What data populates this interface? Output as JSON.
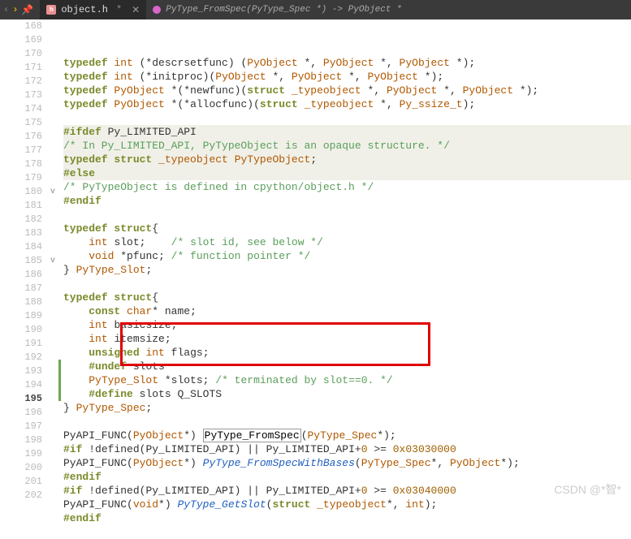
{
  "tabbar": {
    "back": "‹",
    "fwd": "›",
    "pin": "📌",
    "tab": {
      "icon": "h",
      "name": "object.h",
      "modified": "*",
      "close": "✕"
    },
    "breadcrumb": "PyType_FromSpec(PyType_Spec *) -> PyObject *"
  },
  "lines": [
    {
      "n": 168,
      "tokens": [
        [
          "kw",
          "typedef"
        ],
        [
          "op",
          " "
        ],
        [
          "ty",
          "int"
        ],
        [
          "op",
          " (*"
        ],
        [
          "id",
          "descrsetfunc"
        ],
        [
          "op",
          ") ("
        ],
        [
          "ty",
          "PyObject"
        ],
        [
          "op",
          " *, "
        ],
        [
          "ty",
          "PyObject"
        ],
        [
          "op",
          " *, "
        ],
        [
          "ty",
          "PyObject"
        ],
        [
          "op",
          " *);"
        ]
      ]
    },
    {
      "n": 169,
      "tokens": [
        [
          "kw",
          "typedef"
        ],
        [
          "op",
          " "
        ],
        [
          "ty",
          "int"
        ],
        [
          "op",
          " (*"
        ],
        [
          "id",
          "initproc"
        ],
        [
          "op",
          ")("
        ],
        [
          "ty",
          "PyObject"
        ],
        [
          "op",
          " *, "
        ],
        [
          "ty",
          "PyObject"
        ],
        [
          "op",
          " *, "
        ],
        [
          "ty",
          "PyObject"
        ],
        [
          "op",
          " *);"
        ]
      ]
    },
    {
      "n": 170,
      "tokens": [
        [
          "kw",
          "typedef"
        ],
        [
          "op",
          " "
        ],
        [
          "ty",
          "PyObject"
        ],
        [
          "op",
          " *(*"
        ],
        [
          "id",
          "newfunc"
        ],
        [
          "op",
          ")("
        ],
        [
          "kw",
          "struct"
        ],
        [
          "op",
          " "
        ],
        [
          "ty",
          "_typeobject"
        ],
        [
          "op",
          " *, "
        ],
        [
          "ty",
          "PyObject"
        ],
        [
          "op",
          " *, "
        ],
        [
          "ty",
          "PyObject"
        ],
        [
          "op",
          " *);"
        ]
      ]
    },
    {
      "n": 171,
      "tokens": [
        [
          "kw",
          "typedef"
        ],
        [
          "op",
          " "
        ],
        [
          "ty",
          "PyObject"
        ],
        [
          "op",
          " *(*"
        ],
        [
          "id",
          "allocfunc"
        ],
        [
          "op",
          ")("
        ],
        [
          "kw",
          "struct"
        ],
        [
          "op",
          " "
        ],
        [
          "ty",
          "_typeobject"
        ],
        [
          "op",
          " *, "
        ],
        [
          "ty",
          "Py_ssize_t"
        ],
        [
          "op",
          ");"
        ]
      ]
    },
    {
      "n": 172,
      "tokens": []
    },
    {
      "n": 173,
      "tokens": [
        [
          "pp",
          "#ifdef"
        ],
        [
          "op",
          " "
        ],
        [
          "id",
          "Py_LIMITED_API"
        ]
      ],
      "hl": true
    },
    {
      "n": 174,
      "tokens": [
        [
          "cm",
          "/* In Py_LIMITED_API, PyTypeObject is an opaque structure. */"
        ]
      ],
      "hl": true
    },
    {
      "n": 175,
      "tokens": [
        [
          "kw",
          "typedef"
        ],
        [
          "op",
          " "
        ],
        [
          "kw",
          "struct"
        ],
        [
          "op",
          " "
        ],
        [
          "ty",
          "_typeobject"
        ],
        [
          "op",
          " "
        ],
        [
          "ty",
          "PyTypeObject"
        ],
        [
          "op",
          ";"
        ]
      ],
      "hl": true
    },
    {
      "n": 176,
      "tokens": [
        [
          "pp",
          "#else"
        ]
      ],
      "hl": true
    },
    {
      "n": 177,
      "tokens": [
        [
          "cm",
          "/* PyTypeObject is defined in cpython/object.h */"
        ]
      ]
    },
    {
      "n": 178,
      "tokens": [
        [
          "pp",
          "#endif"
        ]
      ]
    },
    {
      "n": 179,
      "tokens": []
    },
    {
      "n": 180,
      "tokens": [
        [
          "kw",
          "typedef"
        ],
        [
          "op",
          " "
        ],
        [
          "kw",
          "struct"
        ],
        [
          "op",
          "{"
        ]
      ],
      "fold": "v"
    },
    {
      "n": 181,
      "tokens": [
        [
          "op",
          "    "
        ],
        [
          "ty",
          "int"
        ],
        [
          "op",
          " "
        ],
        [
          "id",
          "slot"
        ],
        [
          "op",
          ";    "
        ],
        [
          "cm",
          "/* slot id, see below */"
        ]
      ]
    },
    {
      "n": 182,
      "tokens": [
        [
          "op",
          "    "
        ],
        [
          "ty",
          "void"
        ],
        [
          "op",
          " *"
        ],
        [
          "id",
          "pfunc"
        ],
        [
          "op",
          "; "
        ],
        [
          "cm",
          "/* function pointer */"
        ]
      ]
    },
    {
      "n": 183,
      "tokens": [
        [
          "op",
          "} "
        ],
        [
          "ty",
          "PyType_Slot"
        ],
        [
          "op",
          ";"
        ]
      ]
    },
    {
      "n": 184,
      "tokens": []
    },
    {
      "n": 185,
      "tokens": [
        [
          "kw",
          "typedef"
        ],
        [
          "op",
          " "
        ],
        [
          "kw",
          "struct"
        ],
        [
          "op",
          "{"
        ]
      ],
      "fold": "v"
    },
    {
      "n": 186,
      "tokens": [
        [
          "op",
          "    "
        ],
        [
          "kw",
          "const"
        ],
        [
          "op",
          " "
        ],
        [
          "ty",
          "char"
        ],
        [
          "op",
          "* "
        ],
        [
          "id",
          "name"
        ],
        [
          "op",
          ";"
        ]
      ]
    },
    {
      "n": 187,
      "tokens": [
        [
          "op",
          "    "
        ],
        [
          "ty",
          "int"
        ],
        [
          "op",
          " "
        ],
        [
          "id",
          "basicsize"
        ],
        [
          "op",
          ";"
        ]
      ]
    },
    {
      "n": 188,
      "tokens": [
        [
          "op",
          "    "
        ],
        [
          "ty",
          "int"
        ],
        [
          "op",
          " "
        ],
        [
          "id",
          "itemsize"
        ],
        [
          "op",
          ";"
        ]
      ]
    },
    {
      "n": 189,
      "tokens": [
        [
          "op",
          "    "
        ],
        [
          "kw",
          "unsigned"
        ],
        [
          "op",
          " "
        ],
        [
          "ty",
          "int"
        ],
        [
          "op",
          " "
        ],
        [
          "id",
          "flags"
        ],
        [
          "op",
          ";"
        ]
      ]
    },
    {
      "n": 190,
      "tokens": [
        [
          "op",
          "    "
        ],
        [
          "pp",
          "#undef"
        ],
        [
          "op",
          " "
        ],
        [
          "id",
          "slots"
        ]
      ],
      "green": true
    },
    {
      "n": 191,
      "tokens": [
        [
          "op",
          "    "
        ],
        [
          "ty",
          "PyType_Slot"
        ],
        [
          "op",
          " *"
        ],
        [
          "id",
          "slots"
        ],
        [
          "op",
          "; "
        ],
        [
          "cm",
          "/* terminated by slot==0. */"
        ]
      ],
      "green": true
    },
    {
      "n": 192,
      "tokens": [
        [
          "op",
          "    "
        ],
        [
          "pp",
          "#define"
        ],
        [
          "op",
          " "
        ],
        [
          "id",
          "slots"
        ],
        [
          "op",
          " "
        ],
        [
          "id",
          "Q_SLOTS"
        ]
      ],
      "green": true
    },
    {
      "n": 193,
      "tokens": [
        [
          "op",
          "} "
        ],
        [
          "ty",
          "PyType_Spec"
        ],
        [
          "op",
          ";"
        ]
      ]
    },
    {
      "n": 194,
      "tokens": []
    },
    {
      "n": 195,
      "tokens": [
        [
          "id",
          "PyAPI_FUNC"
        ],
        [
          "op",
          "("
        ],
        [
          "ty",
          "PyObject"
        ],
        [
          "op",
          "*) "
        ],
        [
          "fnref",
          "PyType_FromSpec"
        ],
        [
          "op",
          "("
        ],
        [
          "ty",
          "PyType_Spec"
        ],
        [
          "op",
          "*);"
        ]
      ],
      "current": true
    },
    {
      "n": 196,
      "tokens": [
        [
          "pp",
          "#if"
        ],
        [
          "op",
          " !"
        ],
        [
          "id",
          "defined"
        ],
        [
          "op",
          "("
        ],
        [
          "id",
          "Py_LIMITED_API"
        ],
        [
          "op",
          ") || "
        ],
        [
          "id",
          "Py_LIMITED_API"
        ],
        [
          "op",
          "+"
        ],
        [
          "num",
          "0"
        ],
        [
          "op",
          " >= "
        ],
        [
          "num",
          "0x03030000"
        ]
      ]
    },
    {
      "n": 197,
      "tokens": [
        [
          "id",
          "PyAPI_FUNC"
        ],
        [
          "op",
          "("
        ],
        [
          "ty",
          "PyObject"
        ],
        [
          "op",
          "*) "
        ],
        [
          "fn",
          "PyType_FromSpecWithBases"
        ],
        [
          "op",
          "("
        ],
        [
          "ty",
          "PyType_Spec"
        ],
        [
          "op",
          "*, "
        ],
        [
          "ty",
          "PyObject"
        ],
        [
          "op",
          "*);"
        ]
      ]
    },
    {
      "n": 198,
      "tokens": [
        [
          "pp",
          "#endif"
        ]
      ]
    },
    {
      "n": 199,
      "tokens": [
        [
          "pp",
          "#if"
        ],
        [
          "op",
          " !"
        ],
        [
          "id",
          "defined"
        ],
        [
          "op",
          "("
        ],
        [
          "id",
          "Py_LIMITED_API"
        ],
        [
          "op",
          ") || "
        ],
        [
          "id",
          "Py_LIMITED_API"
        ],
        [
          "op",
          "+"
        ],
        [
          "num",
          "0"
        ],
        [
          "op",
          " >= "
        ],
        [
          "num",
          "0x03040000"
        ]
      ]
    },
    {
      "n": 200,
      "tokens": [
        [
          "id",
          "PyAPI_FUNC"
        ],
        [
          "op",
          "("
        ],
        [
          "ty",
          "void"
        ],
        [
          "op",
          "*) "
        ],
        [
          "fn",
          "PyType_GetSlot"
        ],
        [
          "op",
          "("
        ],
        [
          "kw",
          "struct"
        ],
        [
          "op",
          " "
        ],
        [
          "ty",
          "_typeobject"
        ],
        [
          "op",
          "*, "
        ],
        [
          "ty",
          "int"
        ],
        [
          "op",
          ");"
        ]
      ]
    },
    {
      "n": 201,
      "tokens": [
        [
          "pp",
          "#endif"
        ]
      ]
    },
    {
      "n": 202,
      "tokens": []
    }
  ],
  "watermark": "CSDN @*智*"
}
